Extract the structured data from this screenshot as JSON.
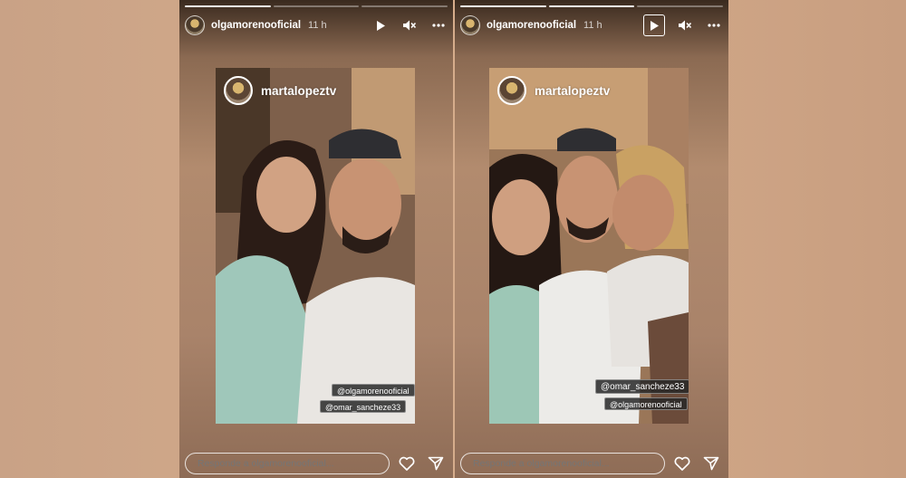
{
  "stories": [
    {
      "username": "olgamorenooficial",
      "time": "11 h",
      "repost_username": "martalopeztv",
      "mentions": [
        "@olgamorenooficial",
        "@omar_sancheze33"
      ],
      "reply_placeholder": "Responde a olgamorenooficial..."
    },
    {
      "username": "olgamorenooficial",
      "time": "11 h",
      "repost_username": "martalopeztv",
      "mentions": [
        "@omar_sancheze33",
        "@olgamorenooficial"
      ],
      "reply_placeholder": "Responde a olgamorenooficial..."
    }
  ],
  "icons": {
    "play": "play-icon",
    "mute": "speaker-muted-icon",
    "more": "more-options-icon",
    "like": "heart-icon",
    "share": "send-icon"
  },
  "colors": {
    "text": "#ffffff",
    "mention_bg": "#282828"
  }
}
